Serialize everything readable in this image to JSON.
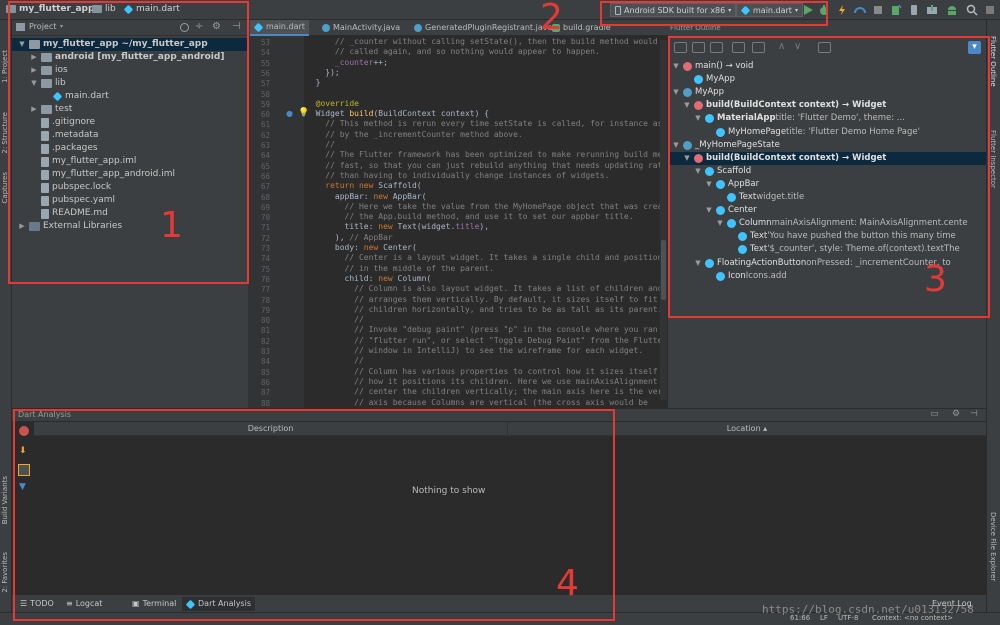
{
  "topbar": {
    "breadcrumbs": [
      "my_flutter_app",
      "lib",
      "main.dart"
    ],
    "device_selector": "Android SDK built for x86",
    "run_config": "main.dart"
  },
  "left_strip": {
    "tabs": [
      "1: Project",
      "2: Structure",
      "Captures"
    ],
    "bottom_tabs": [
      "Build Variants",
      "2: Favorites"
    ]
  },
  "right_strip": {
    "tabs": [
      "Flutter Outline",
      "Flutter Inspector",
      "Device File Explorer"
    ]
  },
  "project": {
    "header": "Project",
    "tree": [
      {
        "label": "my_flutter_app",
        "suffix": "~/my_flutter_app",
        "arrow": "▼",
        "type": "folder",
        "bold": true,
        "selected": true
      },
      {
        "label": "android [my_flutter_app_android]",
        "arrow": "▶",
        "type": "folder",
        "bold": true
      },
      {
        "label": "ios",
        "arrow": "▶",
        "type": "folder"
      },
      {
        "label": "lib",
        "arrow": "▼",
        "type": "folder"
      },
      {
        "label": "main.dart",
        "arrow": "",
        "type": "dart"
      },
      {
        "label": "test",
        "arrow": "▶",
        "type": "folder"
      },
      {
        "label": ".gitignore",
        "arrow": "",
        "type": "file"
      },
      {
        "label": ".metadata",
        "arrow": "",
        "type": "file"
      },
      {
        "label": ".packages",
        "arrow": "",
        "type": "file"
      },
      {
        "label": "my_flutter_app.iml",
        "arrow": "",
        "type": "file"
      },
      {
        "label": "my_flutter_app_android.iml",
        "arrow": "",
        "type": "file"
      },
      {
        "label": "pubspec.lock",
        "arrow": "",
        "type": "file"
      },
      {
        "label": "pubspec.yaml",
        "arrow": "",
        "type": "file"
      },
      {
        "label": "README.md",
        "arrow": "",
        "type": "file"
      },
      {
        "label": "External Libraries",
        "arrow": "▶",
        "type": "lib"
      }
    ]
  },
  "editor": {
    "tabs": [
      "main.dart",
      "MainActivity.java",
      "GeneratedPluginRegistrant.java",
      "build.gradle"
    ],
    "line_numbers": [
      "53",
      "54",
      "55",
      "56",
      "57",
      "58",
      "59",
      "60",
      "61",
      "62",
      "63",
      "64",
      "65",
      "66",
      "67",
      "68",
      "69",
      "70",
      "71",
      "72",
      "73",
      "74",
      "75",
      "76",
      "77",
      "78",
      "79",
      "80",
      "81",
      "82",
      "83",
      "84",
      "85",
      "86",
      "87",
      "88"
    ],
    "lines": [
      [
        [
          "cmt",
          "      // _counter without calling setState(), then the build method would not be"
        ]
      ],
      [
        [
          "cmt",
          "      // called again, and so nothing would appear to happen."
        ]
      ],
      [
        [
          "",
          "      "
        ],
        [
          "field",
          "_counter"
        ],
        [
          "",
          "++;"
        ]
      ],
      [
        [
          "",
          "    });"
        ]
      ],
      [
        [
          "",
          "  }"
        ]
      ],
      [
        [
          "",
          ""
        ]
      ],
      [
        [
          "ann",
          "  @override"
        ]
      ],
      [
        [
          "",
          "  Widget "
        ],
        [
          "fn",
          "build"
        ],
        [
          "",
          "(BuildContext context) {"
        ]
      ],
      [
        [
          "cmt",
          "    // This method is rerun every time setState is called, for instance as done"
        ]
      ],
      [
        [
          "cmt",
          "    // by the _incrementCounter method above."
        ]
      ],
      [
        [
          "cmt",
          "    //"
        ]
      ],
      [
        [
          "cmt",
          "    // The Flutter framework has been optimized to make rerunning build methods"
        ]
      ],
      [
        [
          "cmt",
          "    // fast, so that you can just rebuild anything that needs updating rather"
        ]
      ],
      [
        [
          "cmt",
          "    // than having to individually change instances of widgets."
        ]
      ],
      [
        [
          "kw",
          "    return new "
        ],
        [
          "",
          "Scaffold("
        ]
      ],
      [
        [
          "",
          "      appBar: "
        ],
        [
          "kw",
          "new "
        ],
        [
          "",
          "AppBar("
        ]
      ],
      [
        [
          "cmt",
          "        // Here we take the value from the MyHomePage object that was created by"
        ]
      ],
      [
        [
          "cmt",
          "        // the App.build method, and use it to set our appbar title."
        ]
      ],
      [
        [
          "",
          "        title: "
        ],
        [
          "kw",
          "new "
        ],
        [
          "",
          "Text(widget."
        ],
        [
          "field",
          "title"
        ],
        [
          "",
          "),"
        ]
      ],
      [
        [
          "",
          "      ), "
        ],
        [
          "cmt",
          "// AppBar"
        ]
      ],
      [
        [
          "",
          "      body: "
        ],
        [
          "kw",
          "new "
        ],
        [
          "",
          "Center("
        ]
      ],
      [
        [
          "cmt",
          "        // Center is a layout widget. It takes a single child and positions it"
        ]
      ],
      [
        [
          "cmt",
          "        // in the middle of the parent."
        ]
      ],
      [
        [
          "",
          "        child: "
        ],
        [
          "kw",
          "new "
        ],
        [
          "",
          "Column("
        ]
      ],
      [
        [
          "cmt",
          "          // Column is also layout widget. It takes a list of children and"
        ]
      ],
      [
        [
          "cmt",
          "          // arranges them vertically. By default, it sizes itself to fit its"
        ]
      ],
      [
        [
          "cmt",
          "          // children horizontally, and tries to be as tall as its parent."
        ]
      ],
      [
        [
          "cmt",
          "          //"
        ]
      ],
      [
        [
          "cmt",
          "          // Invoke \"debug paint\" (press \"p\" in the console where you ran"
        ]
      ],
      [
        [
          "cmt",
          "          // \"flutter run\", or select \"Toggle Debug Paint\" from the Flutter tool"
        ]
      ],
      [
        [
          "cmt",
          "          // window in IntelliJ) to see the wireframe for each widget."
        ]
      ],
      [
        [
          "cmt",
          "          //"
        ]
      ],
      [
        [
          "cmt",
          "          // Column has various properties to control how it sizes itself and"
        ]
      ],
      [
        [
          "cmt",
          "          // how it positions its children. Here we use mainAxisAlignment to"
        ]
      ],
      [
        [
          "cmt",
          "          // center the children vertically; the main axis here is the vertical"
        ]
      ],
      [
        [
          "cmt",
          "          // axis because Columns are vertical (the cross axis would be"
        ]
      ]
    ]
  },
  "outline": {
    "title": "Flutter Outline",
    "rows": [
      {
        "indent": 0,
        "arrow": "▼",
        "icon": "method",
        "label": "main() → void",
        "extra": "",
        "bold": false
      },
      {
        "indent": 1,
        "arrow": "",
        "icon": "widget",
        "label": "MyApp",
        "extra": "",
        "bold": false
      },
      {
        "indent": 0,
        "arrow": "▼",
        "icon": "class",
        "label": "MyApp",
        "extra": "",
        "bold": false
      },
      {
        "indent": 1,
        "arrow": "▼",
        "icon": "method",
        "label": "build(BuildContext context) → Widget",
        "extra": "",
        "bold": true
      },
      {
        "indent": 2,
        "arrow": "▼",
        "icon": "widget",
        "label": "MaterialApp",
        "extra": " title: 'Flutter Demo', theme: ...",
        "bold": true
      },
      {
        "indent": 3,
        "arrow": "",
        "icon": "widget",
        "label": "MyHomePage",
        "extra": " title: 'Flutter Demo Home Page'",
        "bold": false
      },
      {
        "indent": 0,
        "arrow": "▼",
        "icon": "class",
        "label": "_MyHomePageState",
        "extra": "",
        "bold": false
      },
      {
        "indent": 1,
        "arrow": "▼",
        "icon": "method",
        "label": "build(BuildContext context) → Widget",
        "extra": "",
        "bold": true,
        "selected": true
      },
      {
        "indent": 2,
        "arrow": "▼",
        "icon": "widget",
        "label": "Scaffold",
        "extra": "",
        "bold": false
      },
      {
        "indent": 3,
        "arrow": "▼",
        "icon": "widget",
        "label": "AppBar",
        "extra": "",
        "bold": false
      },
      {
        "indent": 4,
        "arrow": "",
        "icon": "widget",
        "label": "Text",
        "extra": " widget.title",
        "bold": false
      },
      {
        "indent": 3,
        "arrow": "▼",
        "icon": "widget",
        "label": "Center",
        "extra": "",
        "bold": false
      },
      {
        "indent": 4,
        "arrow": "▼",
        "icon": "widget",
        "label": "Column",
        "extra": " mainAxisAlignment: MainAxisAlignment.cente",
        "bold": false
      },
      {
        "indent": 5,
        "arrow": "",
        "icon": "widget",
        "label": "Text",
        "extra": " 'You have pushed the button this many time",
        "bold": false
      },
      {
        "indent": 5,
        "arrow": "",
        "icon": "widget",
        "label": "Text",
        "extra": " '$_counter', style: Theme.of(context).textThe",
        "bold": false
      },
      {
        "indent": 2,
        "arrow": "▼",
        "icon": "widget",
        "label": "FloatingActionButton",
        "extra": " onPressed: _incrementCounter, to",
        "bold": false
      },
      {
        "indent": 3,
        "arrow": "",
        "icon": "widget",
        "label": "Icon",
        "extra": " Icons.add",
        "bold": false
      }
    ]
  },
  "analysis": {
    "title": "Dart Analysis",
    "col_description": "Description",
    "col_location": "Location ▴",
    "empty_text": "Nothing to show"
  },
  "bottom_tabs": [
    "TODO",
    "Logcat",
    "Terminal",
    "Dart Analysis"
  ],
  "event_log": "Event Log",
  "status": {
    "position": "61:66",
    "line_sep": "LF",
    "encoding": "UTF-8",
    "context": "Context: <no context>"
  },
  "annotations": [
    "1",
    "2",
    "3",
    "4"
  ],
  "watermark": "https://blog.csdn.net/u013132758",
  "colors": {
    "annotation": "#e53935",
    "selection": "#0d293e",
    "dart_blue": "#40c4ff",
    "run_green": "#59a869"
  }
}
